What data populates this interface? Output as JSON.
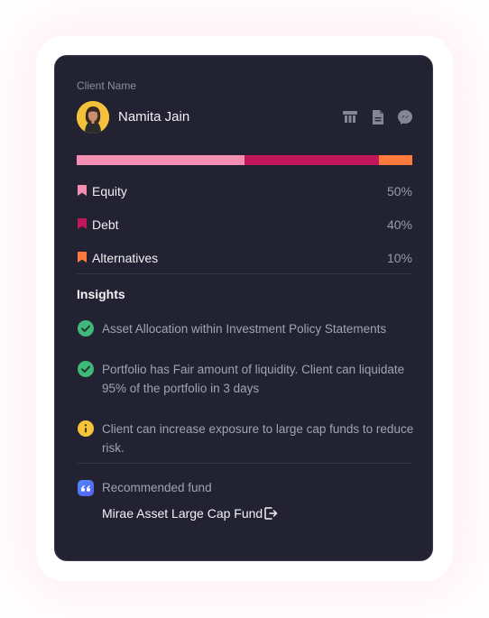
{
  "client": {
    "label": "Client Name",
    "name": "Namita Jain"
  },
  "header_icons": [
    "bank-icon",
    "document-icon",
    "messenger-icon"
  ],
  "allocation": {
    "items": [
      {
        "label": "Equity",
        "percent_text": "50%",
        "value": 50,
        "color": "#f48fb1"
      },
      {
        "label": "Debt",
        "percent_text": "40%",
        "value": 40,
        "color": "#c2185b"
      },
      {
        "label": "Alternatives",
        "percent_text": "10%",
        "value": 10,
        "color": "#ff7a3d"
      }
    ]
  },
  "insights": {
    "title": "Insights",
    "items": [
      {
        "type": "success",
        "icon": "check-circle-icon",
        "text": "Asset Allocation within Investment Policy Statements",
        "color": "#3fb87a"
      },
      {
        "type": "success",
        "icon": "check-circle-icon",
        "text": "Portfolio has Fair amount of liquidity. Client can liquidate 95% of the portfolio in 3 days",
        "color": "#3fb87a"
      },
      {
        "type": "info",
        "icon": "info-circle-icon",
        "text": "Client can increase exposure to large cap funds to reduce risk.",
        "color": "#f5c43a"
      }
    ]
  },
  "recommendation": {
    "label": "Recommended fund",
    "icon": "quote-icon",
    "fund_name": "Mirae Asset Large Cap Fund",
    "link_icon": "external-link-icon"
  }
}
